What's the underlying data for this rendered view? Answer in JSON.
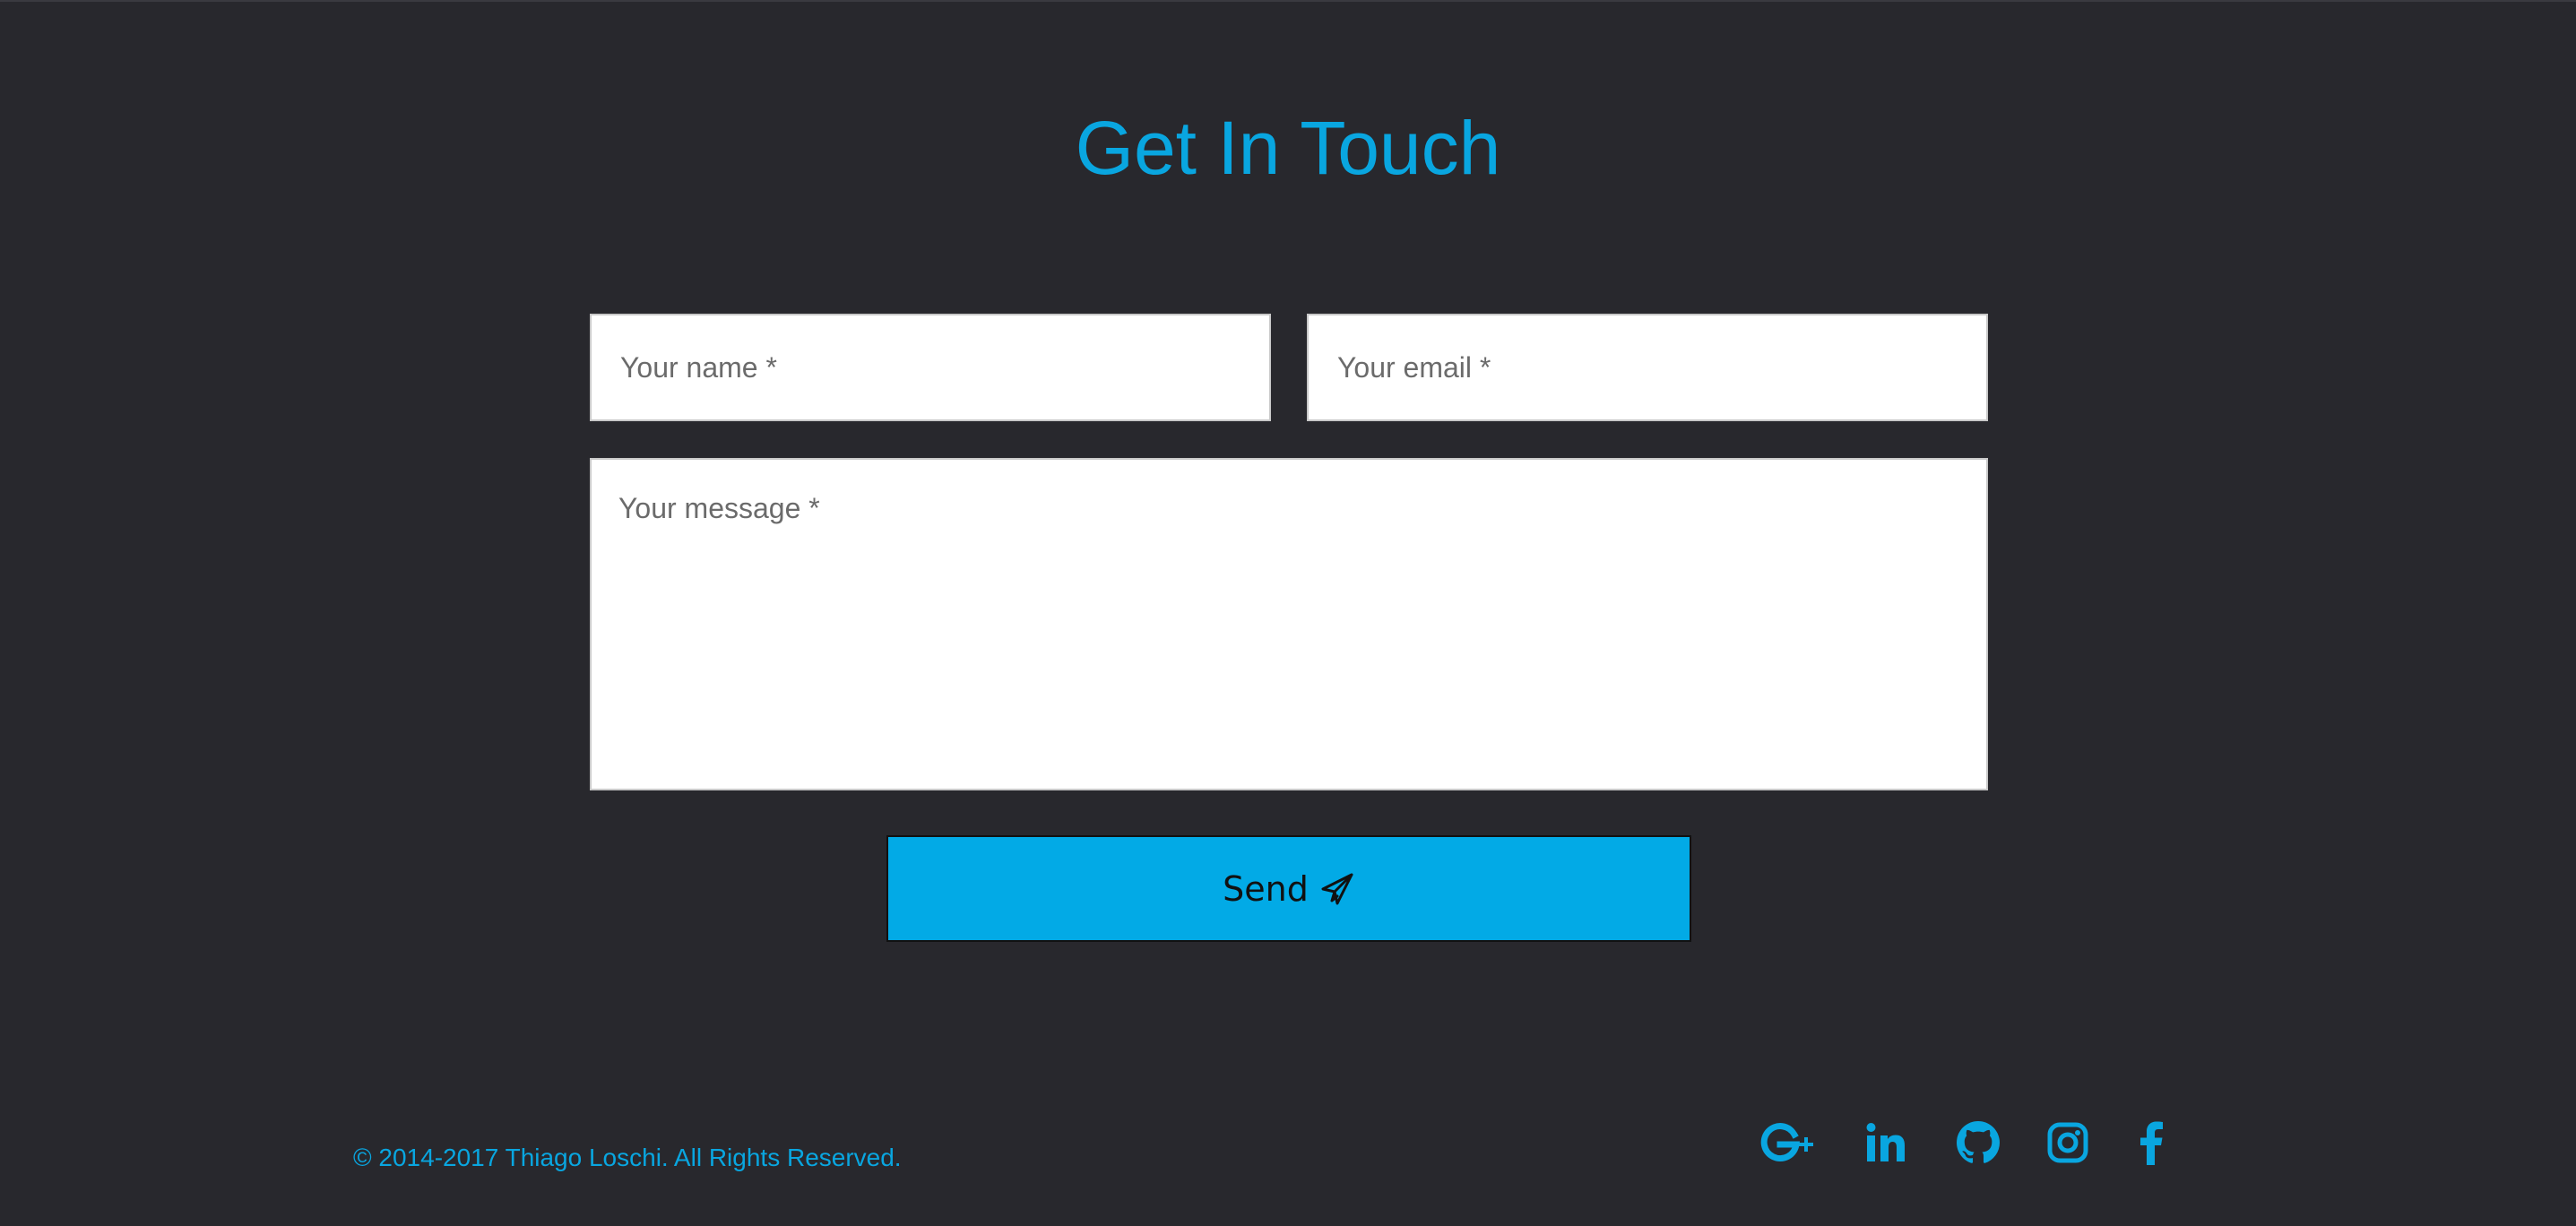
{
  "section": {
    "title": "Get In Touch"
  },
  "form": {
    "name_placeholder": "Your name *",
    "email_placeholder": "Your email *",
    "message_placeholder": "Your message *",
    "send_label": "Send",
    "send_icon": "paper-plane-icon"
  },
  "footer": {
    "copyright": "© 2014-2017 Thiago Loschi. All Rights Reserved.",
    "social": [
      {
        "icon": "google-plus-icon"
      },
      {
        "icon": "linkedin-icon"
      },
      {
        "icon": "github-icon"
      },
      {
        "icon": "instagram-icon"
      },
      {
        "icon": "facebook-icon"
      }
    ]
  },
  "colors": {
    "background": "#28282d",
    "accent": "#09a6e0",
    "button": "#02aae6",
    "field_bg": "#ffffff"
  }
}
